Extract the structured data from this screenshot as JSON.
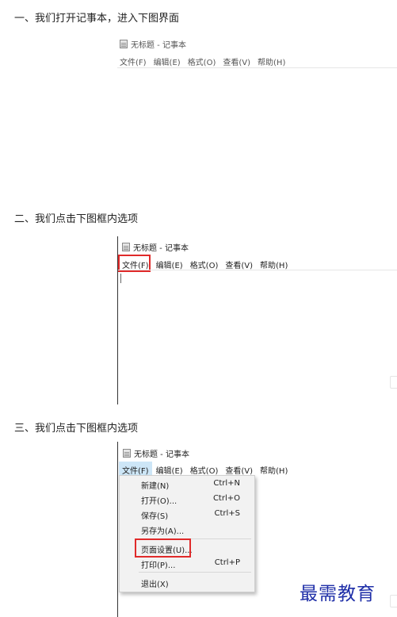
{
  "steps": [
    "一、我们打开记事本，进入下图界面",
    "二、我们点击下图框内选项",
    "三、我们点击下图框内选项"
  ],
  "notepad": {
    "title": "无标题 - 记事本",
    "menu": [
      "文件(F)",
      "编辑(E)",
      "格式(O)",
      "查看(V)",
      "帮助(H)"
    ]
  },
  "file_menu": {
    "items": [
      {
        "label": "新建(N)",
        "shortcut": "Ctrl+N"
      },
      {
        "label": "打开(O)...",
        "shortcut": "Ctrl+O"
      },
      {
        "label": "保存(S)",
        "shortcut": "Ctrl+S"
      },
      {
        "label": "另存为(A)...",
        "shortcut": ""
      },
      {
        "label": "页面设置(U)...",
        "shortcut": ""
      },
      {
        "label": "打印(P)...",
        "shortcut": "Ctrl+P"
      },
      {
        "label": "退出(X)",
        "shortcut": ""
      }
    ]
  },
  "watermark": "最需教育",
  "colors": {
    "highlight_box": "#e02a2a",
    "brand": "#1f2fa8"
  }
}
